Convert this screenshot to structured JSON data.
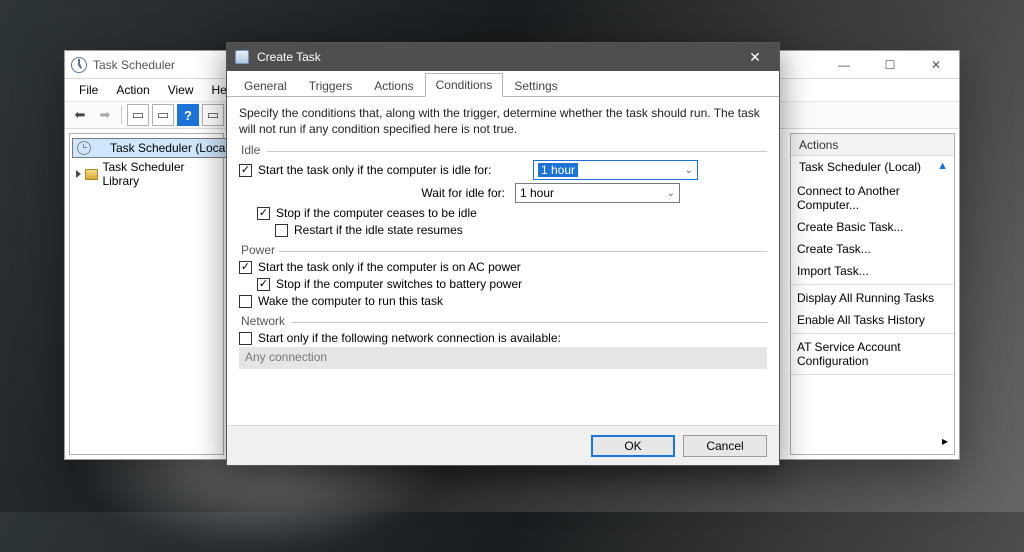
{
  "mainWindow": {
    "title": "Task Scheduler",
    "menu": {
      "file": "File",
      "action": "Action",
      "view": "View",
      "help": "Help"
    },
    "tree": {
      "root": "Task Scheduler (Local)",
      "lib": "Task Scheduler Library"
    },
    "actionsPane": {
      "header": "Actions",
      "subHeader": "Task Scheduler (Local)",
      "items": {
        "connect": "Connect to Another Computer...",
        "createBasic": "Create Basic Task...",
        "createTask": "Create Task...",
        "importTask": "Import Task...",
        "running": "Display All Running Tasks",
        "history": "Enable All Tasks History",
        "atconfig": "AT Service Account Configuration"
      }
    }
  },
  "dialog": {
    "title": "Create Task",
    "tabs": {
      "general": "General",
      "triggers": "Triggers",
      "actions": "Actions",
      "conditions": "Conditions",
      "settings": "Settings"
    },
    "description": "Specify the conditions that, along with the trigger, determine whether the task should run.  The task will not run  if any condition specified here is not true.",
    "groups": {
      "idle": "Idle",
      "power": "Power",
      "network": "Network"
    },
    "idle": {
      "onlyIdle": "Start the task only if the computer is idle for:",
      "idleFor": "1 hour",
      "waitLabel": "Wait for idle for:",
      "waitFor": "1 hour",
      "stopCease": "Stop if the computer ceases to be idle",
      "restart": "Restart if the idle state resumes"
    },
    "power": {
      "onAC": "Start the task only if the computer is on AC power",
      "stopBattery": "Stop if the computer switches to battery power",
      "wake": "Wake the computer to run this task"
    },
    "network": {
      "onlyNet": "Start only if the following network connection is available:",
      "connection": "Any connection"
    },
    "buttons": {
      "ok": "OK",
      "cancel": "Cancel"
    }
  }
}
